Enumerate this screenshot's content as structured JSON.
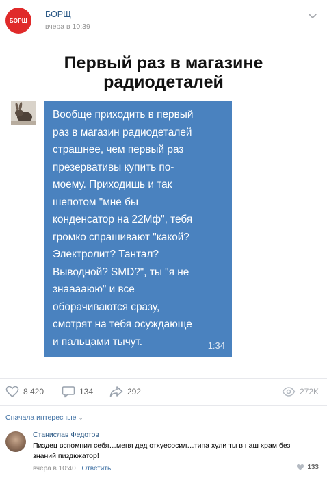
{
  "post": {
    "community_avatar_text": "БОРЩ",
    "author": "БОРЩ",
    "time": "вчера в 10:39"
  },
  "meme": {
    "title_line1": "Первый раз в магазине",
    "title_line2": "радиодеталей",
    "message_lines": [
      "Вообще приходить в первый",
      "раз в магазин радиодеталей",
      "страшнее, чем первый раз",
      "презервативы купить по-",
      "моему. Приходишь и так",
      "шепотом \"мне бы",
      "конденсатор на 22Мф\", тебя",
      "громко спрашивают \"какой?",
      "Электролит? Тантал?",
      "Выводной? SMD?\", ты \"я не",
      "знааааюю\" и все",
      "оборачиваются сразу,",
      "смотрят на тебя осуждающе",
      "и пальцами тычут."
    ],
    "message_time": "1:34",
    "bubble_color": "#4a82bf"
  },
  "actions": {
    "likes": "8 420",
    "comments": "134",
    "shares": "292",
    "views": "272K"
  },
  "comments_section": {
    "sort_label": "Сначала интересные"
  },
  "comment": {
    "author": "Станислав Федотов",
    "text": "Пиздец вспомнил себя…меня дед отхуесосил…типа хули ты в наш храм без знаний пиздюкатор!",
    "time": "вчера в 10:40",
    "reply_label": "Ответить",
    "likes": "133"
  },
  "colors": {
    "link": "#2a5885",
    "accent": "#e02a2a",
    "muted": "#939393"
  }
}
